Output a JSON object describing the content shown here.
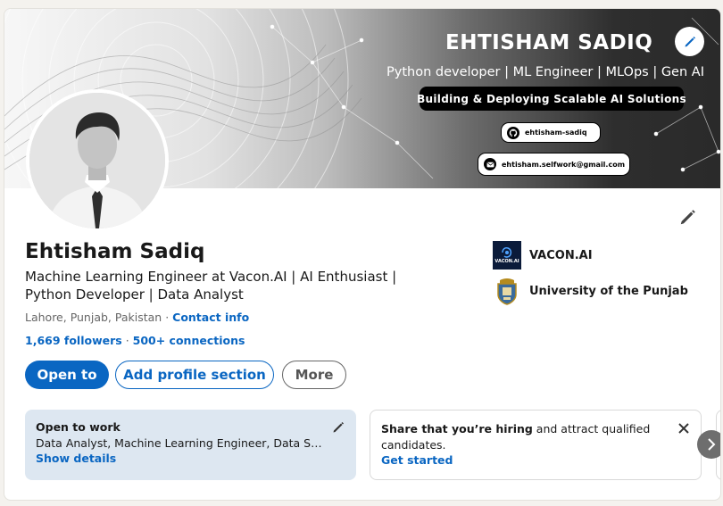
{
  "banner": {
    "name": "EHTISHAM SADIQ",
    "roles": "Python  developer | ML Engineer | MLOps | Gen AI",
    "tagline": "Building & Deploying Scalable AI Solutions",
    "github": "ehtisham-sadiq",
    "email": "ehtisham.selfwork@gmail.com"
  },
  "profile": {
    "name": "Ehtisham Sadiq",
    "headline": "Machine Learning Engineer at Vacon.AI | AI Enthusiast | Python Developer | Data Analyst",
    "location": "Lahore, Punjab, Pakistan",
    "location_sep": " · ",
    "contact_info": "Contact info",
    "followers": "1,669 followers",
    "stats_sep": " · ",
    "connections": "500+ connections"
  },
  "actions": {
    "open_to": "Open to",
    "add_section": "Add profile section",
    "more": "More"
  },
  "experience": [
    {
      "name": "VACON.AI",
      "logo_text": "VACON.AI"
    },
    {
      "name": "University of the Punjab"
    }
  ],
  "open_to_work": {
    "title": "Open to work",
    "roles": "Data Analyst, Machine Learning Engineer, Data S…",
    "link": "Show details"
  },
  "hiring": {
    "bold": "Share that you’re hiring",
    "rest": " and attract qualified candidates.",
    "link": "Get started"
  },
  "icons": {
    "edit": "pencil-icon",
    "close": "close-icon",
    "next": "chevron-right-icon",
    "github": "github-icon",
    "email": "envelope-icon"
  },
  "colors": {
    "accent": "#0a66c2",
    "open_to_work_bg": "#dde7f1"
  }
}
